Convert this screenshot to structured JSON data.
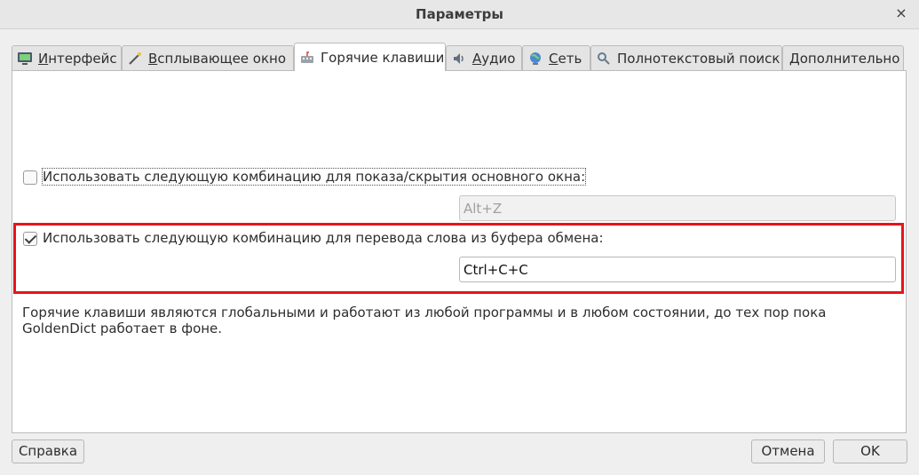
{
  "window": {
    "title": "Параметры",
    "close_glyph": "×"
  },
  "tabs": [
    {
      "icon": "monitor-icon",
      "label": "Интерфейс",
      "mnemonic": "И"
    },
    {
      "icon": "wand-icon",
      "label": "Всплывающее окно",
      "mnemonic": "В"
    },
    {
      "icon": "keyboard-icon",
      "label": "Горячие клавиши",
      "active": true
    },
    {
      "icon": "speaker-icon",
      "label": "Аудио",
      "mnemonic": "А"
    },
    {
      "icon": "globe-icon",
      "label": "Сеть",
      "mnemonic": "С"
    },
    {
      "icon": "magnifier-icon",
      "label": "Полнотекстовый поиск"
    },
    {
      "label": "Дополнительно"
    }
  ],
  "hotkeys": {
    "show_hide": {
      "label": "Использовать следующую комбинацию для показа/скрытия основного окна:",
      "checked": false,
      "value": "Alt+Z"
    },
    "clipboard": {
      "label": "Использовать следующую комбинацию для перевода слова из буфера обмена:",
      "checked": true,
      "value": "Ctrl+C+C"
    },
    "note": "Горячие клавиши являются глобальными и работают из любой программы и в любом состоянии, до тех пор пока GoldenDict работает в фоне."
  },
  "buttons": {
    "help": "Справка",
    "cancel": "Отмена",
    "ok": "OK"
  },
  "colors": {
    "highlight": "#e8141a",
    "background": "#efefef"
  }
}
